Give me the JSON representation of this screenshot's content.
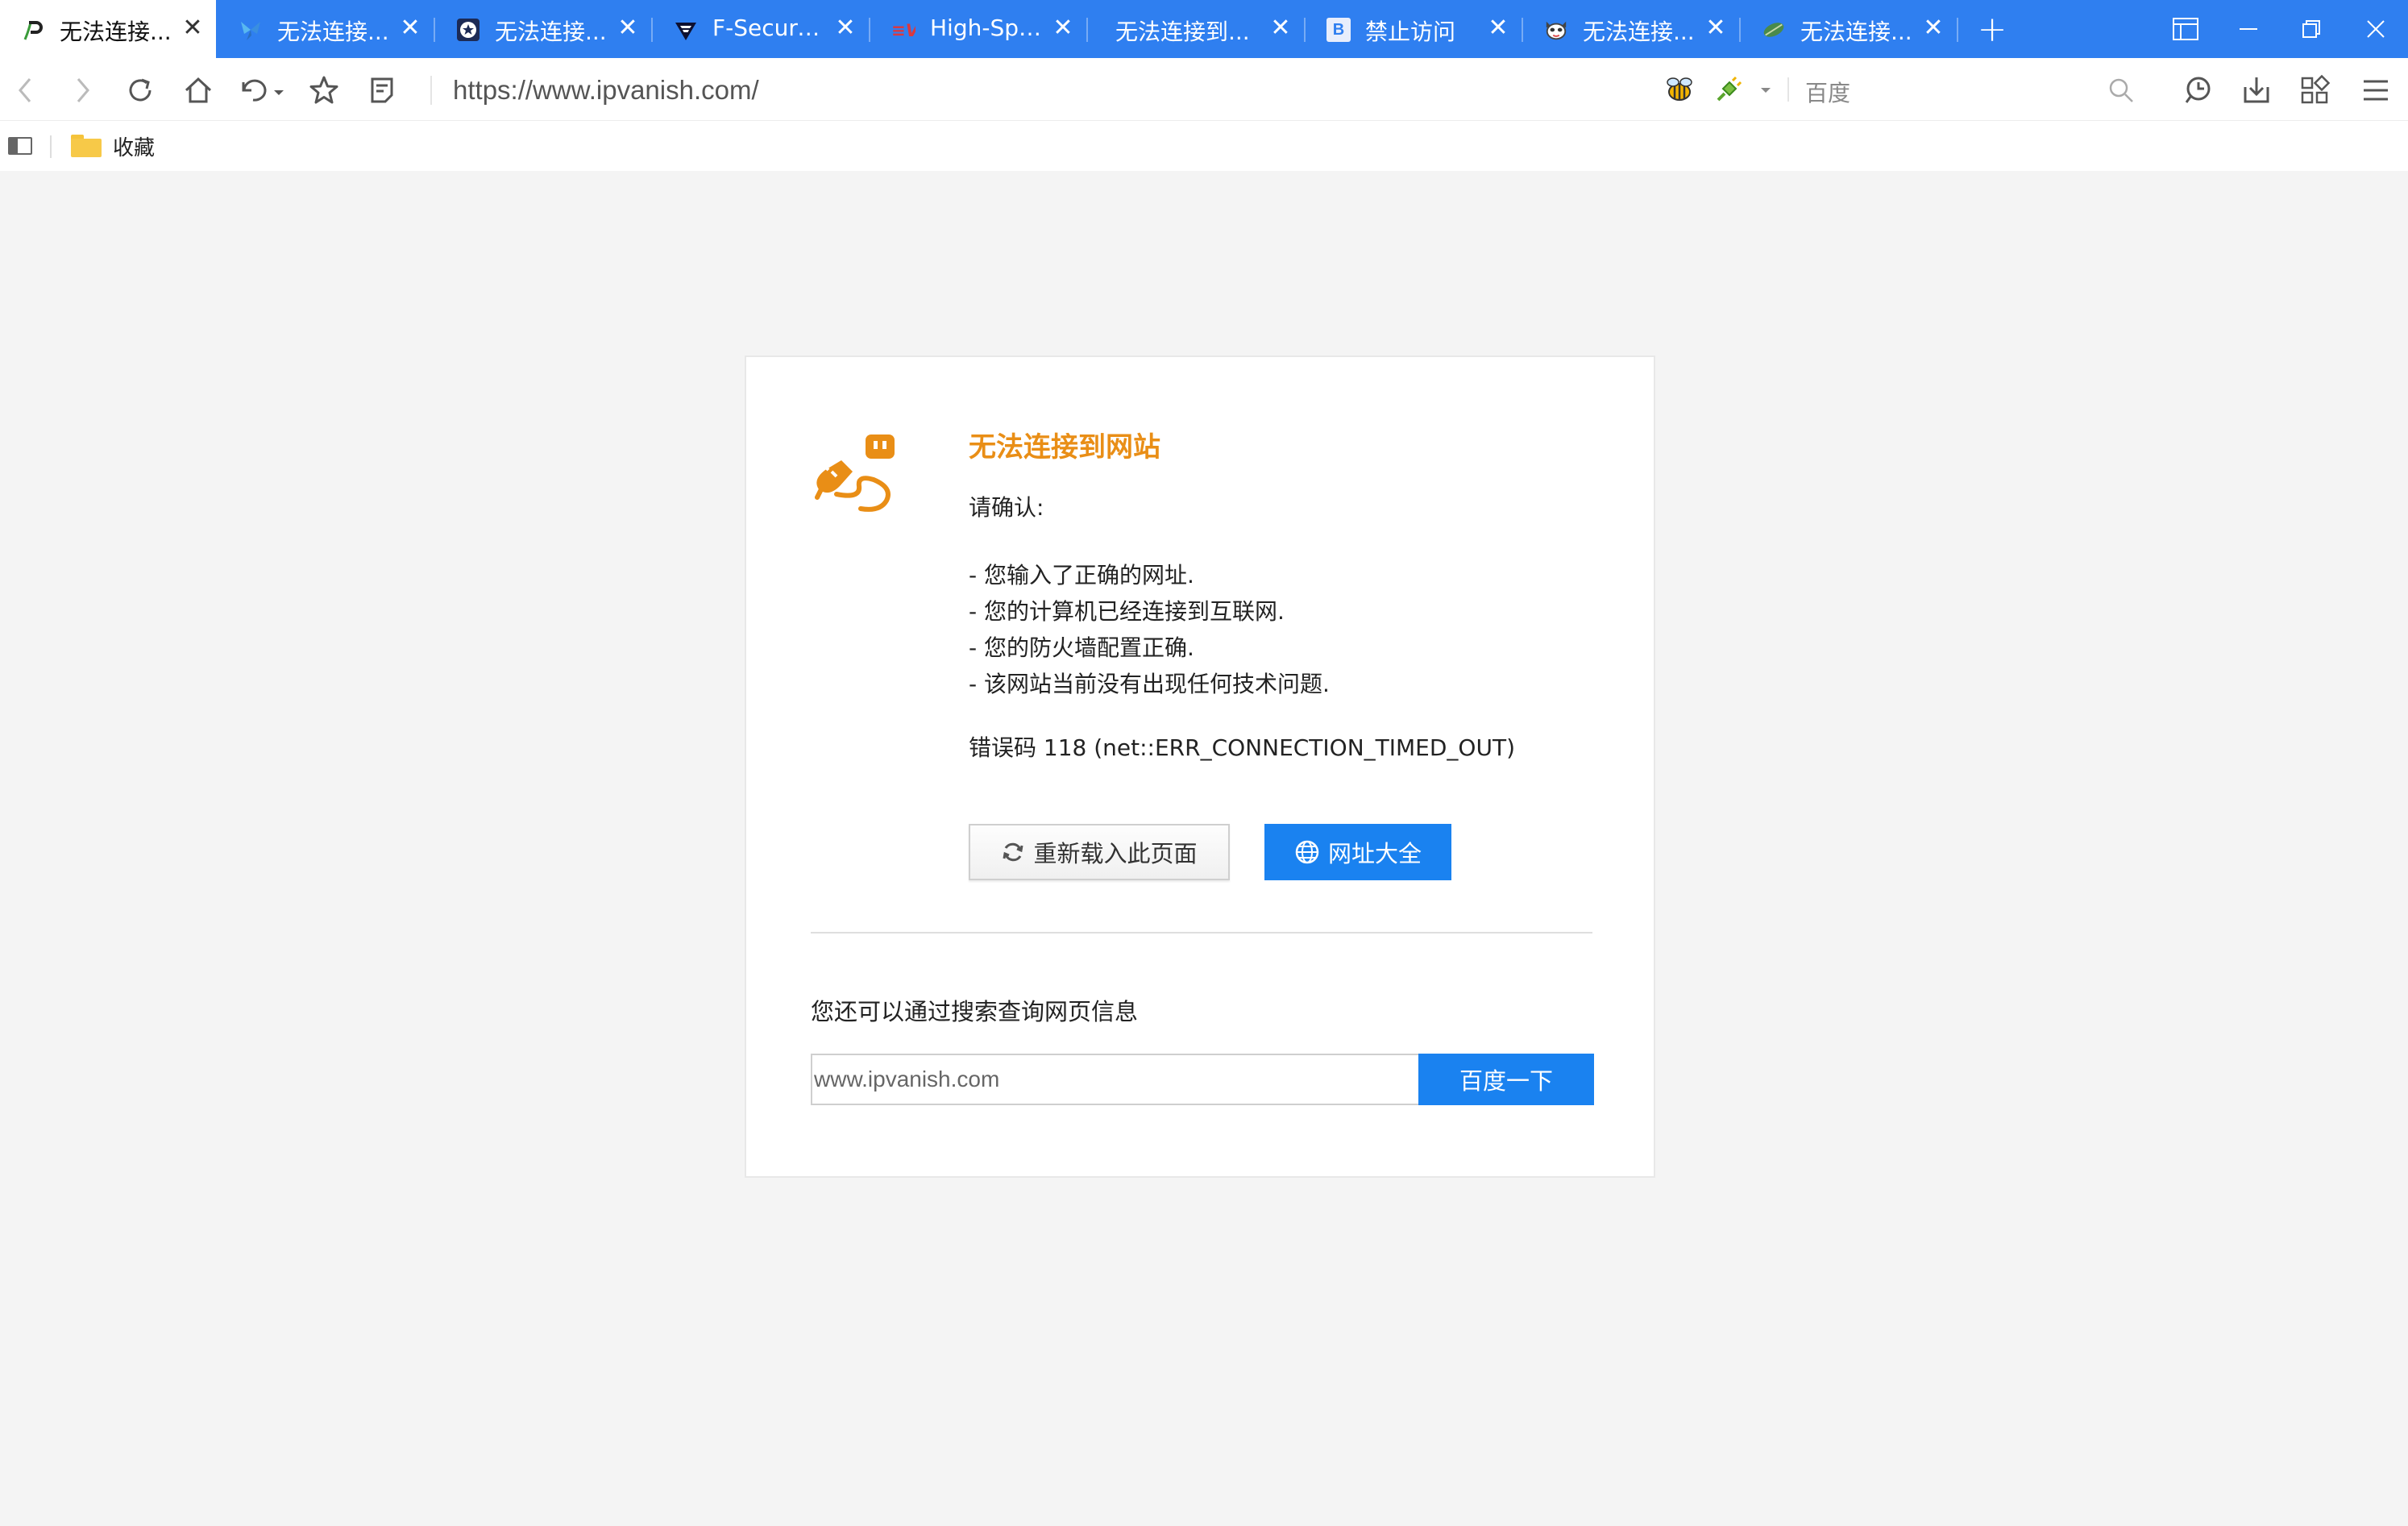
{
  "tabs": [
    {
      "title": "无法连接...",
      "favicon": "p-logo-icon",
      "active": true,
      "close": "✕"
    },
    {
      "title": "无法连接...",
      "favicon": "butterfly-icon",
      "active": false,
      "close": "✕"
    },
    {
      "title": "无法连接...",
      "favicon": "star-badge-icon",
      "active": false,
      "close": "✕"
    },
    {
      "title": "F-Secure ...",
      "favicon": "f-secure-icon",
      "active": false,
      "close": "✕"
    },
    {
      "title": "High-Spe...",
      "favicon": "expressvpn-icon",
      "active": false,
      "close": "✕"
    },
    {
      "title": "无法连接到...",
      "favicon": "",
      "active": false,
      "close": "✕"
    },
    {
      "title": "禁止访问",
      "favicon": "b-letter-icon",
      "active": false,
      "close": "✕"
    },
    {
      "title": "无法连接...",
      "favicon": "mascot-icon",
      "active": false,
      "close": "✕"
    },
    {
      "title": "无法连接...",
      "favicon": "leaf-icon",
      "active": false,
      "close": "✕"
    }
  ],
  "new_tab_label": "+",
  "address_bar": {
    "url": "https://www.ipvanish.com/"
  },
  "search_engine": {
    "placeholder": "百度"
  },
  "bookmarks": {
    "folder_label": "收藏"
  },
  "error_page": {
    "title": "无法连接到网站",
    "confirm_heading": "请确认:",
    "checklist": [
      "- 您输入了正确的网址.",
      "- 您的计算机已经连接到互联网.",
      "- 您的防火墙配置正确.",
      "- 该网站当前没有出现任何技术问题."
    ],
    "error_code": "错误码 118 (net::ERR_CONNECTION_TIMED_OUT)",
    "reload_button": "重新载入此页面",
    "directory_button": "网址大全",
    "search_hint": "您还可以通过搜索查询网页信息",
    "search_value": "www.ipvanish.com",
    "search_button": "百度一下"
  },
  "colors": {
    "tabbar": "#2f7ff0",
    "accent_blue": "#1a82f0",
    "error_orange": "#e98e16",
    "page_background": "#f4f4f4"
  }
}
